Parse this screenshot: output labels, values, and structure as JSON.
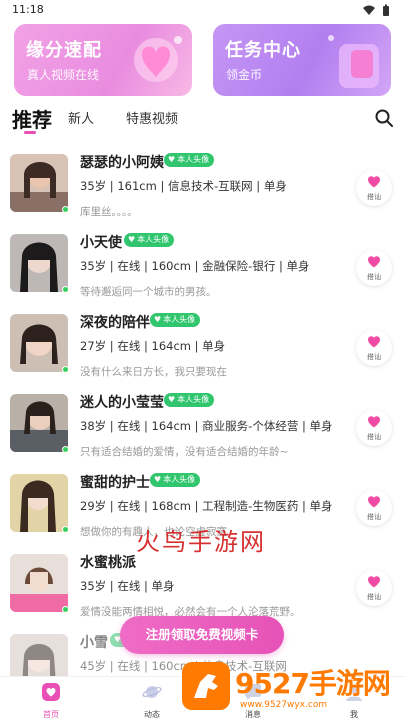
{
  "status_bar": {
    "time": "11:18"
  },
  "banners": [
    {
      "title": "缘分速配",
      "subtitle": "真人视频在线"
    },
    {
      "title": "任务中心",
      "subtitle": "领金币"
    }
  ],
  "tabs": {
    "active": "推荐",
    "items": [
      "新人",
      "特惠视频"
    ]
  },
  "badge_text": "本人头像",
  "greet_label": "搭讪",
  "profiles": [
    {
      "name": "瑟瑟的小阿姨",
      "info": "35岁 | 161cm | 信息技术-互联网 | 单身",
      "desc": "库里丝。。。。",
      "verified": true
    },
    {
      "name": "小天使",
      "info": "35岁 | 在线 | 160cm | 金融保险-银行 | 单身",
      "desc": "等待邂逅同一个城市的男孩。",
      "verified": true
    },
    {
      "name": "深夜的陪伴",
      "info": "27岁 | 在线 | 164cm | 单身",
      "desc": "没有什么来日方长，我只要现在",
      "verified": true
    },
    {
      "name": "迷人的小莹莹",
      "info": "38岁 | 在线 | 164cm | 商业服务-个体经营 | 单身",
      "desc": "只有适合结婚的爱情，没有适合结婚的年龄~",
      "verified": true
    },
    {
      "name": "蜜甜的护士",
      "info": "29岁 | 在线 | 168cm | 工程制造-生物医药 | 单身",
      "desc": "想做你的有趣人，也论空虚寂寞",
      "verified": true
    },
    {
      "name": "水蜜桃派",
      "info": "35岁 | 在线 | 单身",
      "desc": "爱情没能两情相悦，必然会有一个人沦落荒野。",
      "verified": false
    },
    {
      "name": "小雪",
      "info": "45岁 | 在线 | 160cm | 信息技术-互联网",
      "desc": "",
      "verified": true
    }
  ],
  "cta": "注册领取免费视频卡",
  "nav": [
    {
      "label": "首页",
      "icon": "home-icon"
    },
    {
      "label": "动态",
      "icon": "planet-icon"
    },
    {
      "label": "消息",
      "icon": "message-icon"
    },
    {
      "label": "我",
      "icon": "user-icon"
    }
  ],
  "watermark": {
    "center": "火鸟手游网",
    "logo_big": "9527手游网",
    "logo_small": "www.9527wyx.com"
  },
  "colors": {
    "accent": "#e94fb4",
    "badge": "#31c66e",
    "online": "#3ad15a"
  }
}
